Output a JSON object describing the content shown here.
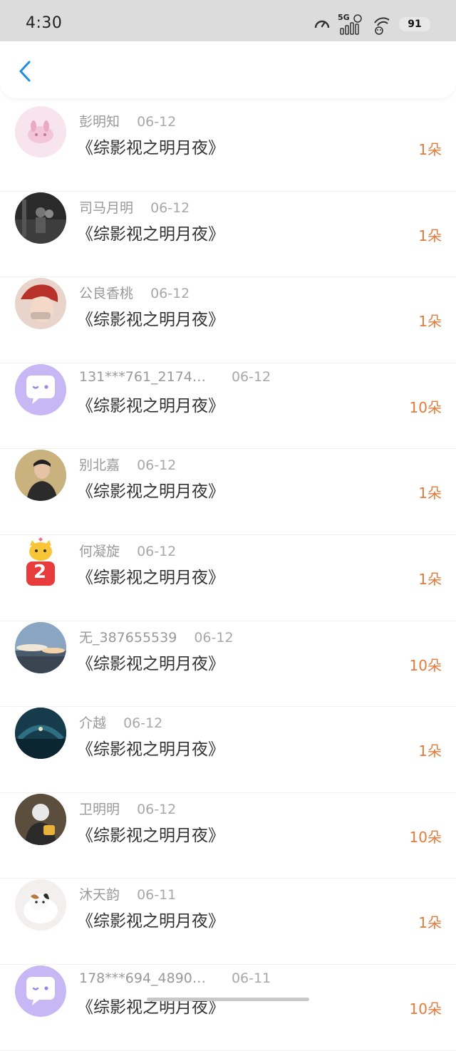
{
  "status_bar": {
    "time": "4:30",
    "network": "5G",
    "battery": "91",
    "icons": [
      "speed-meter-icon",
      "signal-bars-icon",
      "wifi-icon",
      "battery-icon"
    ]
  },
  "header": {
    "back_icon": "chevron-left-icon",
    "accent_color": "#1e8fe0"
  },
  "colors": {
    "amount": "#e47b3a",
    "username": "#999999",
    "title": "#333333"
  },
  "gifts": [
    {
      "user": "彭明知",
      "date": "06-12",
      "title": "《综影视之明月夜》",
      "amount": "1朵",
      "avatar": "pink-bunny-avatar"
    },
    {
      "user": "司马月明",
      "date": "06-12",
      "title": "《综影视之明月夜》",
      "amount": "1朵",
      "avatar": "dark-photo-avatar"
    },
    {
      "user": "公良香桃",
      "date": "06-12",
      "title": "《综影视之明月夜》",
      "amount": "1朵",
      "avatar": "red-hair-avatar"
    },
    {
      "user": "131***761_2174…",
      "date": "06-12",
      "title": "《综影视之明月夜》",
      "amount": "10朵",
      "avatar": "default-chat-avatar"
    },
    {
      "user": "别北嘉",
      "date": "06-12",
      "title": "《综影视之明月夜》",
      "amount": "1朵",
      "avatar": "man-portrait-avatar"
    },
    {
      "user": "何凝旋",
      "date": "06-12",
      "title": "《综影视之明月夜》",
      "amount": "1朵",
      "avatar": "yellow-cat-2-avatar"
    },
    {
      "user": "无_387655539",
      "date": "06-12",
      "title": "《综影视之明月夜》",
      "amount": "10朵",
      "avatar": "sky-clouds-avatar"
    },
    {
      "user": "介越",
      "date": "06-12",
      "title": "《综影视之明月夜》",
      "amount": "1朵",
      "avatar": "bridge-night-avatar"
    },
    {
      "user": "卫明明",
      "date": "06-12",
      "title": "《综影视之明月夜》",
      "amount": "10朵",
      "avatar": "hoodie-person-avatar"
    },
    {
      "user": "沐天韵",
      "date": "06-11",
      "title": "《综影视之明月夜》",
      "amount": "1朵",
      "avatar": "kitten-avatar"
    },
    {
      "user": "178***694_4890…",
      "date": "06-11",
      "title": "《综影视之明月夜》",
      "amount": "10朵",
      "avatar": "default-chat-avatar"
    }
  ]
}
